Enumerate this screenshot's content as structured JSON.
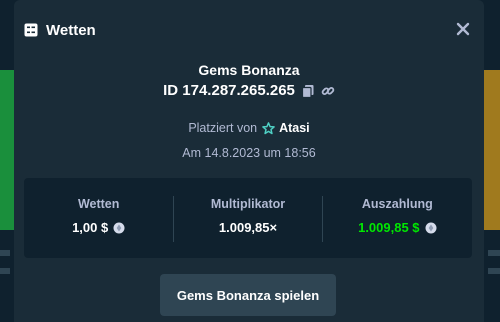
{
  "modal": {
    "title": "Wetten"
  },
  "bet": {
    "game_name": "Gems Bonanza",
    "id_text": "ID 174.287.265.265",
    "placed_by_label": "Platziert von",
    "username": "Atasi",
    "date": "Am 14.8.2023 um 18:56"
  },
  "stats": {
    "wager_label": "Wetten",
    "wager_value": "1,00 $",
    "multiplier_label": "Multiplikator",
    "multiplier_value": "1.009,85×",
    "payout_label": "Auszahlung",
    "payout_value": "1.009,85 $"
  },
  "actions": {
    "play_label": "Gems Bonanza spielen"
  },
  "colors": {
    "modal_bg": "#1a2c38",
    "stats_bg": "#0f212e",
    "payout_green": "#00e701",
    "muted_text": "#b1bad3",
    "button_bg": "#2f4553"
  },
  "icons": {
    "header": "bet-slip-icon",
    "close": "close-icon",
    "copy": "copy-icon",
    "link": "link-icon",
    "user_rank": "star-icon",
    "currency": "coin-icon"
  }
}
